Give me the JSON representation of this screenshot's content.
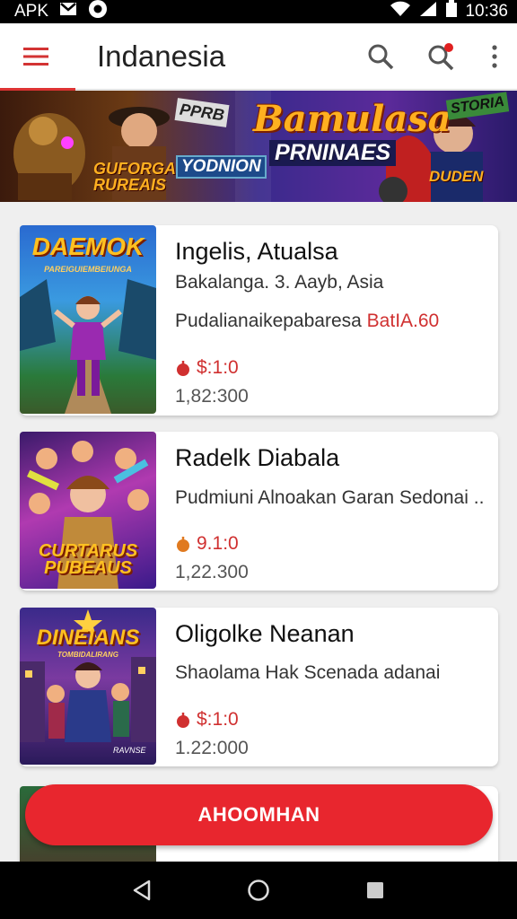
{
  "status_bar": {
    "left_text": "APK",
    "time": "10:36"
  },
  "app_bar": {
    "title": "Indanesia",
    "icons": [
      "menu-icon",
      "search-icon",
      "search-notification-icon",
      "more-vert-icon"
    ],
    "accent_color": "#d33333"
  },
  "banner": {
    "title_line1": "Bamulasa",
    "title_line2": "PRNINAES",
    "left_caption1": "GUFORGAS\nRUREAIS",
    "left_caption2": "YODNION",
    "sign_left": "PPRB",
    "sign_right": "STORIA",
    "bottom_right": "DUDEN"
  },
  "apps": [
    {
      "name": "Ingelis, Atualsa",
      "description": "Bakalanga. 3. Aayb, Asia",
      "extra_prefix": "Pudalianaikepabaresa ",
      "extra_highlight": "BatIA.60",
      "price": "$:1:0",
      "downloads": "1,82:300",
      "thumb_title": "DAEMOK",
      "thumb_subtitle": "PAREIGUIEMBEIUNGA"
    },
    {
      "name": "Radelk Diabala",
      "description": "Pudmiuni Alnoakan Garan Sedonai  ..",
      "price": "9.1:0",
      "downloads": "1,22.300",
      "thumb_title": "CURTARUS\nPUBEAUS"
    },
    {
      "name": "Oligolke Neanan",
      "description": "Shaolama Hak Scenada adanai",
      "price": "$:1:0",
      "downloads": "1.22:000",
      "thumb_title": "DINEIANS",
      "thumb_subtitle": "TOMBIDALIRANG",
      "thumb_label": "RAVNSE"
    }
  ],
  "action_button": {
    "label": "AHOOMHAN",
    "color": "#e8262e"
  },
  "nav_bar": {
    "icons": [
      "back-icon",
      "home-icon",
      "recents-icon"
    ]
  }
}
